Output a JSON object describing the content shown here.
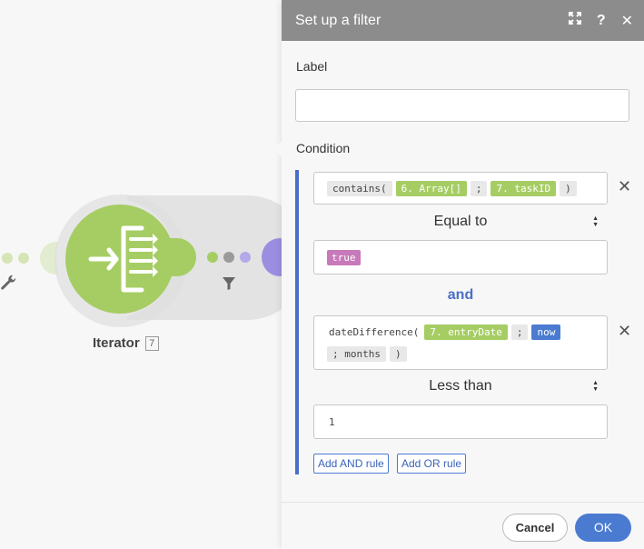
{
  "canvas": {
    "module": {
      "name": "Iterator",
      "badge": "7",
      "icon": "iterator-icon"
    }
  },
  "panel": {
    "title": "Set up a filter",
    "header_icons": [
      "expand-icon",
      "help-icon",
      "close-icon"
    ],
    "label_title": "Label",
    "label_value": "",
    "condition_title": "Condition",
    "rule1": {
      "tokens": [
        {
          "kind": "fn",
          "text": "contains("
        },
        {
          "kind": "var",
          "text": "6. Array[]"
        },
        {
          "kind": "fn",
          "text": ";"
        },
        {
          "kind": "var",
          "text": "7. taskID"
        },
        {
          "kind": "fn",
          "text": ")"
        }
      ],
      "operator": "Equal to",
      "value_token": "true"
    },
    "connector": "and",
    "rule2": {
      "tokens": [
        {
          "kind": "plain",
          "text": "dateDifference("
        },
        {
          "kind": "var",
          "text": "7. entryDate"
        },
        {
          "kind": "fn",
          "text": ";"
        },
        {
          "kind": "kw",
          "text": "now"
        },
        {
          "kind": "fn",
          "text": "; months"
        },
        {
          "kind": "fn",
          "text": ")"
        }
      ],
      "operator": "Less than",
      "value": "1"
    },
    "add_and": "Add AND rule",
    "add_or": "Add OR rule",
    "cancel": "Cancel",
    "ok": "OK"
  },
  "colors": {
    "accent": "#4a7bd1",
    "module_green": "#a6cd64",
    "header_gray": "#8c8c8c",
    "bool_pink": "#c779b9",
    "next_module_purple": "#9b8ee0"
  }
}
